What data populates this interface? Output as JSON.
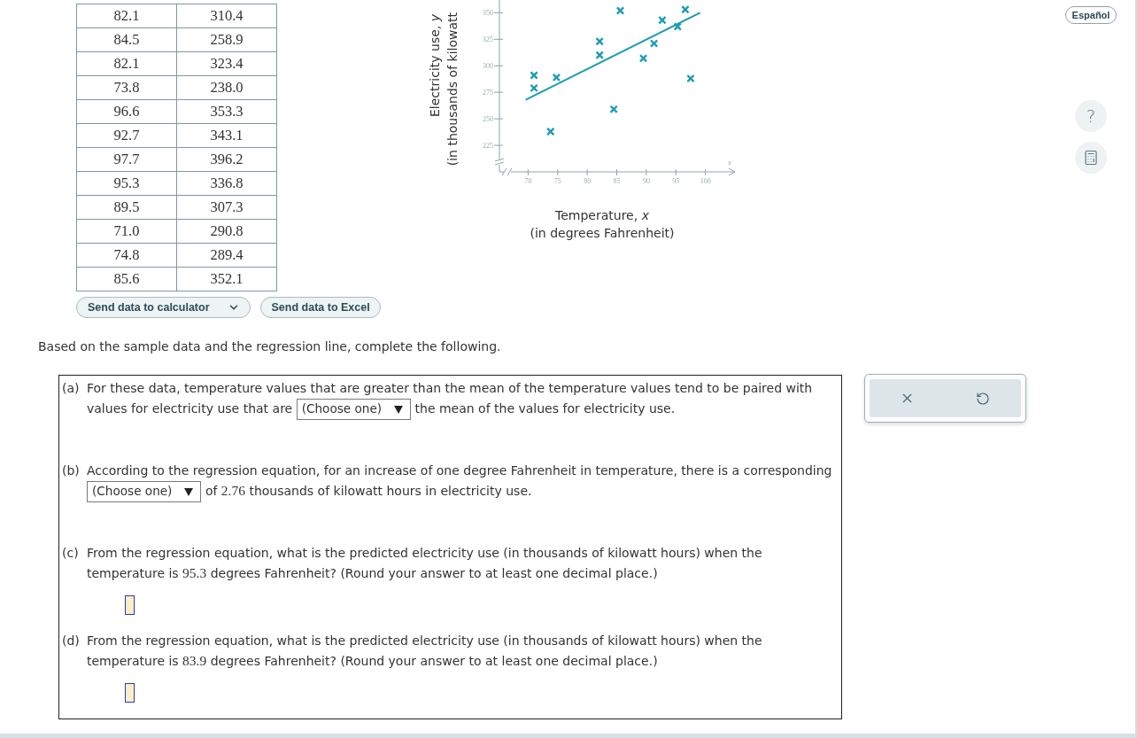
{
  "language_button": {
    "label": "Español"
  },
  "help_button": {
    "label": "?"
  },
  "data_table": {
    "rows": [
      [
        "82.1",
        "310.4"
      ],
      [
        "84.5",
        "258.9"
      ],
      [
        "82.1",
        "323.4"
      ],
      [
        "73.8",
        "238.0"
      ],
      [
        "96.6",
        "353.3"
      ],
      [
        "92.7",
        "343.1"
      ],
      [
        "97.7",
        "396.2"
      ],
      [
        "95.3",
        "336.8"
      ],
      [
        "89.5",
        "307.3"
      ],
      [
        "71.0",
        "290.8"
      ],
      [
        "74.8",
        "289.4"
      ],
      [
        "85.6",
        "352.1"
      ]
    ]
  },
  "table_actions": [
    {
      "label": "Send data to calculator",
      "kind": "menu"
    },
    {
      "label": "Send data to Excel",
      "kind": "plain"
    }
  ],
  "scatter_plot": {
    "y_axis_unit": "(in thousands of kilowatt",
    "x_axis_unit": "(in degrees Fahrenheit)",
    "x_axis_letter": "x",
    "chart_data": {
      "type": "scatter",
      "xlabel": "Temperature, *x*",
      "ylabel": "Electricity use, *y*",
      "xlim": [
        65,
        105
      ],
      "ylim": [
        200,
        362
      ],
      "xticks": [
        70,
        75,
        80,
        85,
        90,
        95,
        100
      ],
      "yticks": [
        225,
        250,
        275,
        300,
        325,
        350
      ],
      "series": [
        {
          "type": "scatter",
          "marker": "cross",
          "color": "#1a9cb0",
          "x": [
            71.0,
            71.0,
            73.8,
            74.8,
            82.1,
            82.1,
            84.5,
            85.6,
            89.5,
            91.3,
            92.7,
            95.3,
            96.6,
            97.5
          ],
          "values": [
            291,
            279,
            238,
            289,
            323,
            310,
            259,
            352,
            307,
            321,
            343,
            337,
            353,
            288
          ]
        },
        {
          "type": "line",
          "color": "#1a9cb0",
          "x": [
            69.6,
            99.1
          ],
          "values": [
            268,
            350
          ]
        }
      ]
    }
  },
  "instruction": "Based on the sample data and the regression line, complete the following.",
  "questions": [
    {
      "label": "(a)",
      "kind": "choice",
      "segments": [
        {
          "kind": "text",
          "text": "For these data, temperature values that are greater than the mean of the temperature values tend to be paired with values for electricity use that are"
        },
        {
          "kind": "select",
          "placeholder": "(Choose one)"
        },
        {
          "kind": "text",
          "text": "the mean of the values for electricity use."
        }
      ]
    },
    {
      "label": "(b)",
      "kind": "choice",
      "segments": [
        {
          "kind": "text",
          "text": "According to the regression equation, for an increase of one degree Fahrenheit in temperature, there is a corresponding"
        },
        {
          "kind": "select",
          "placeholder": "(Choose one)"
        },
        {
          "kind": "text",
          "text": "of"
        },
        {
          "kind": "number",
          "text": "2.76"
        },
        {
          "kind": "text",
          "text": "thousands of kilowatt hours in electricity use."
        }
      ]
    },
    {
      "label": "(c)",
      "kind": "numeric",
      "segments": [
        {
          "kind": "text",
          "text": "From the regression equation, what is the predicted electricity use (in thousands of kilowatt hours) when the temperature is"
        },
        {
          "kind": "number",
          "text": "95.3"
        },
        {
          "kind": "text",
          "text": "degrees Fahrenheit? (Round your answer to at least one decimal place.)"
        }
      ]
    },
    {
      "label": "(d)",
      "kind": "numeric",
      "segments": [
        {
          "kind": "text",
          "text": "From the regression equation, what is the predicted electricity use (in thousands of kilowatt hours) when the temperature is"
        },
        {
          "kind": "number",
          "text": "83.9"
        },
        {
          "kind": "text",
          "text": "degrees Fahrenheit? (Round your answer to at least one decimal place.)"
        }
      ]
    }
  ],
  "answer_tools": [
    {
      "kind": "clear"
    },
    {
      "kind": "undo"
    }
  ]
}
